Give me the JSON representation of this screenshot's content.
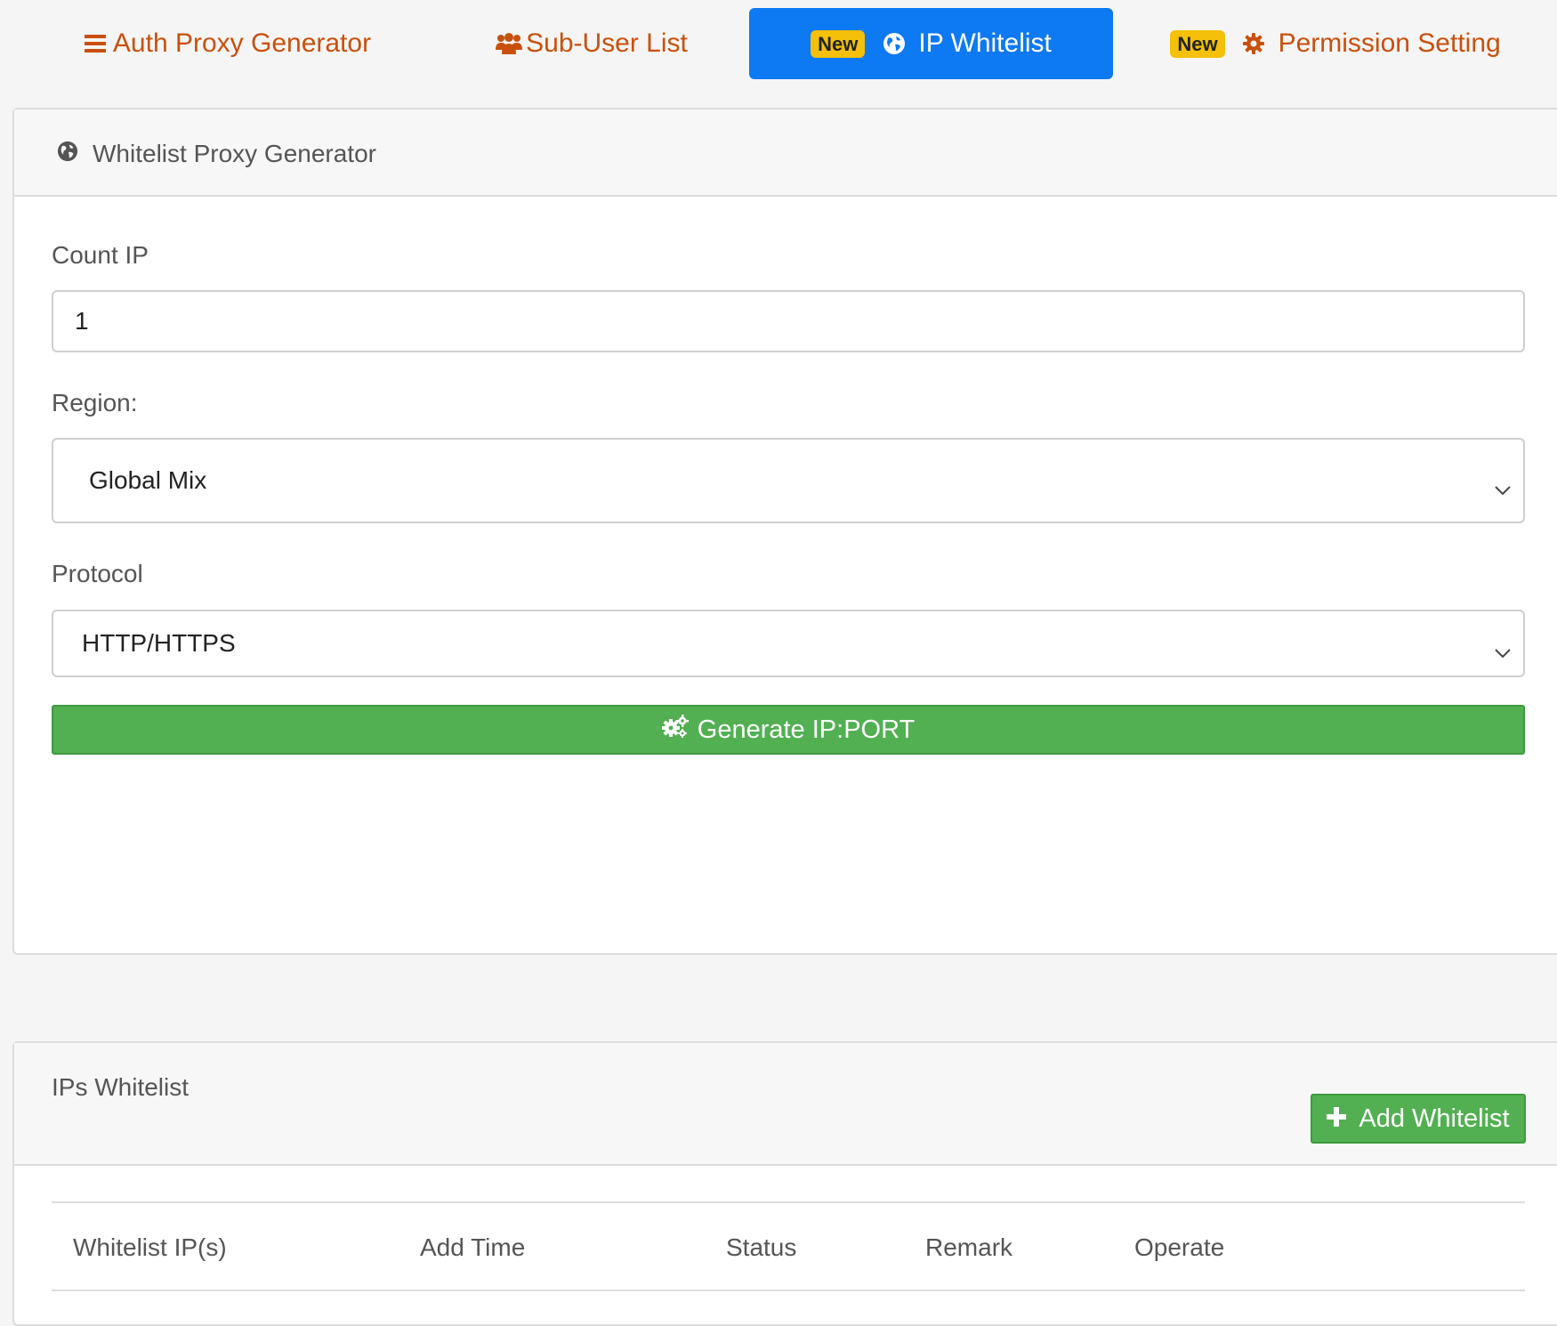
{
  "tabs": [
    {
      "label": "Auth Proxy Generator",
      "icon": "bars-icon"
    },
    {
      "label": "Sub-User List",
      "icon": "users-icon"
    },
    {
      "label": "IP Whitelist",
      "icon": "globe-icon",
      "badge": "New",
      "active": true
    },
    {
      "label": "Permission Setting",
      "icon": "gear-icon",
      "badge": "New"
    }
  ],
  "generator": {
    "title": "Whitelist Proxy Generator",
    "count_label": "Count IP",
    "count_value": "1",
    "region_label": "Region:",
    "region_value": "Global Mix",
    "protocol_label": "Protocol",
    "protocol_value": "HTTP/HTTPS",
    "generate_label": "Generate IP:PORT"
  },
  "whitelist": {
    "title": "IPs Whitelist",
    "add_label": "Add Whitelist",
    "columns": [
      "Whitelist IP(s)",
      "Add Time",
      "Status",
      "Remark",
      "Operate"
    ]
  },
  "colors": {
    "accent_text": "#c9500c",
    "active_tab": "#0d79f2",
    "badge": "#f4c009",
    "button_green": "#52b052"
  }
}
